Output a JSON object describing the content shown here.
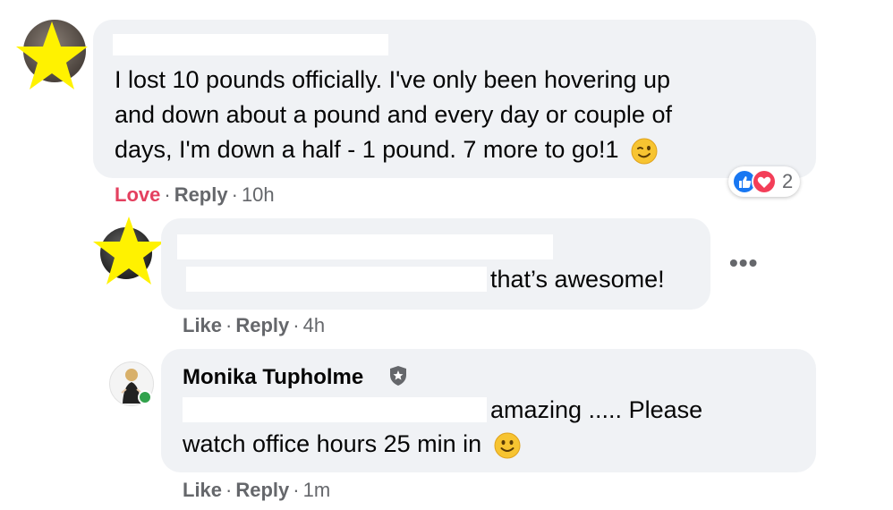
{
  "comment1": {
    "text_line1": "I lost 10 pounds officially. I've only been hovering up",
    "text_line2": "and down about a pound and every day or couple of",
    "text_line3": "days, I'm down a half - 1 pound. 7 more to go!1",
    "reaction_label": "Love",
    "reply_label": "Reply",
    "time": "10h",
    "reaction_count": "2"
  },
  "comment2": {
    "text_tail": "that’s awesome!",
    "like_label": "Like",
    "reply_label": "Reply",
    "time": "4h",
    "more_label": "•••"
  },
  "comment3": {
    "author": "Monika Tupholme",
    "text_tail": "amazing ..... Please",
    "text_line2": "watch office hours 25 min in",
    "like_label": "Like",
    "reply_label": "Reply",
    "time": "1m"
  },
  "colors": {
    "bubble": "#f0f2f5",
    "meta_text": "#65676b",
    "love": "#e4405f",
    "like_blue": "#1877f2",
    "online_green": "#31a24c",
    "star": "#fff200"
  },
  "icons": [
    "star-icon",
    "wink-emoji-icon",
    "smile-emoji-icon",
    "like-reaction-icon",
    "love-reaction-icon",
    "moderator-badge-icon"
  ]
}
